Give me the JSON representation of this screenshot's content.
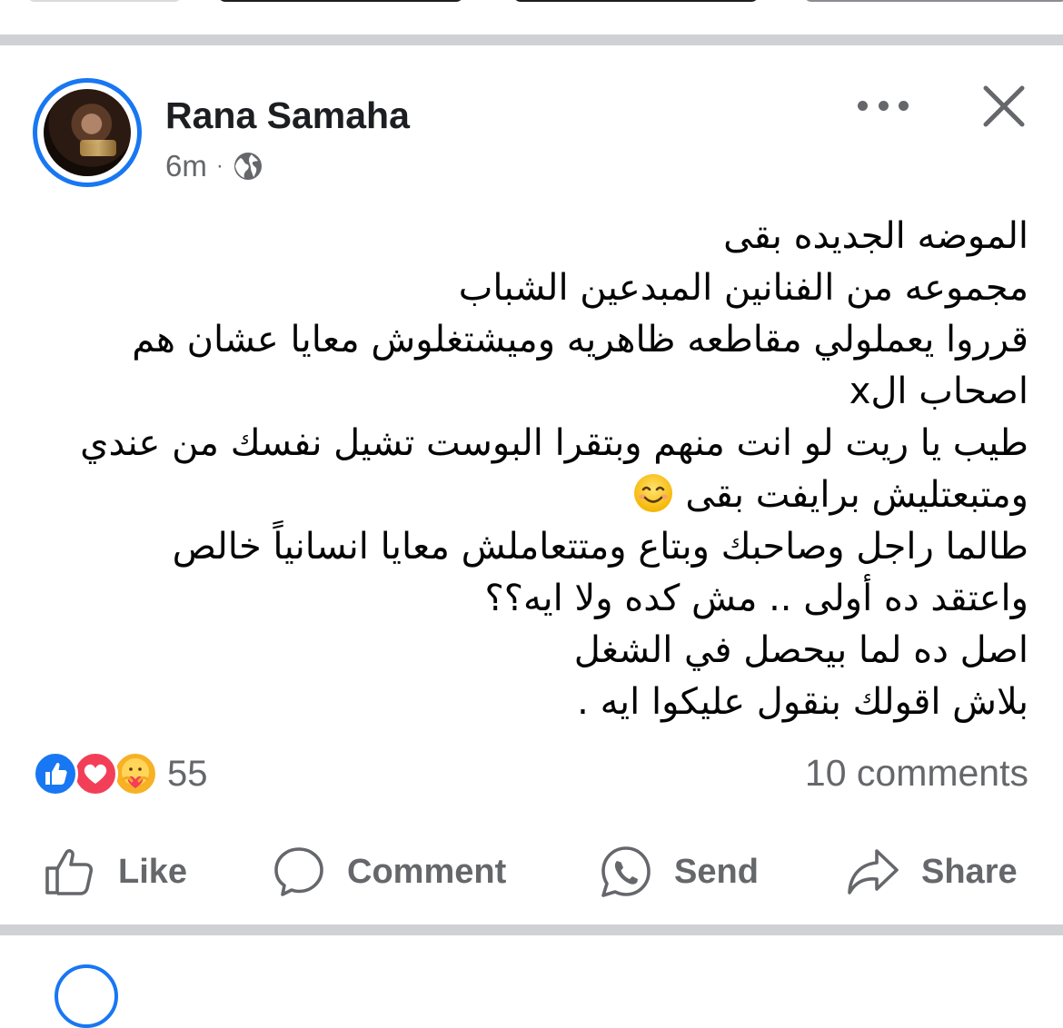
{
  "post": {
    "author": "Rana Samaha",
    "time": "6m",
    "separator": "·",
    "privacy_icon": "globe-icon",
    "lines": [
      "الموضه الجديده بقى",
      "مجموعه من الفنانين المبدعين الشباب",
      "قرروا يعملولي مقاطعه ظاهريه وميشتغلوش معايا عشان هم",
      "اصحاب الx",
      "طيب يا ريت لو انت منهم وبتقرا البوست تشيل نفسك من عندي",
      "ومتبعتليش برايفت بقى",
      "طالما راجل وصاحبك وبتاع ومتتعاملش معايا انسانياً خالص",
      "واعتقد ده أولى .. مش كده ولا ايه؟؟",
      "اصل ده لما بيحصل في الشغل",
      "بلاش اقولك بنقول عليكوا ايه ."
    ],
    "emoji_line_index": 5,
    "emoji_name": "smiling-face-emoji"
  },
  "stats": {
    "reaction_count": "55",
    "reaction_icons": [
      "like-reaction-icon",
      "love-reaction-icon",
      "care-reaction-icon"
    ],
    "comments": "10 comments"
  },
  "actions": {
    "like": "Like",
    "comment": "Comment",
    "send": "Send",
    "share": "Share"
  },
  "colors": {
    "accent": "#1877f2",
    "love": "#f33e58",
    "care": "#f7b125",
    "muted": "#65676b",
    "text": "#050505",
    "divider": "#cfd1d5"
  }
}
